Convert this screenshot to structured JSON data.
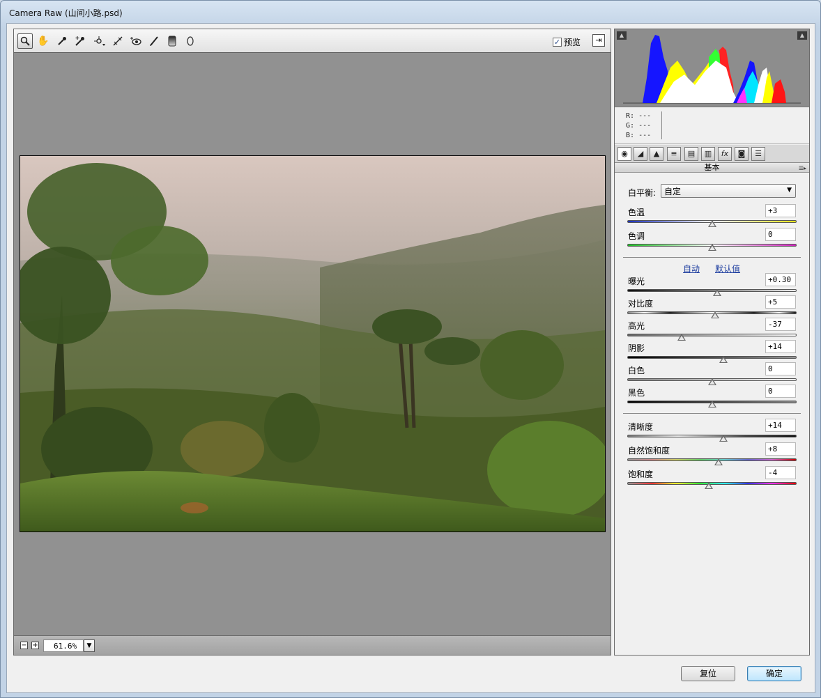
{
  "window": {
    "title": "Camera Raw (山间小路.psd)"
  },
  "toolbar": {
    "tools": [
      "zoom-tool-icon",
      "hand-tool-icon",
      "white-balance-tool-icon",
      "color-sampler-tool-icon",
      "targeted-adjustment-tool-icon",
      "straighten-tool-icon",
      "red-eye-tool-icon",
      "adjustment-brush-icon",
      "graduated-filter-icon",
      "radial-filter-icon"
    ],
    "preview_label": "预览",
    "preview_checked": true
  },
  "status": {
    "zoom_value": "61.6%"
  },
  "info": {
    "r_label": "R:",
    "g_label": "G:",
    "b_label": "B:",
    "r_value": "---",
    "g_value": "---",
    "b_value": "---"
  },
  "panel": {
    "section_title": "基本",
    "white_balance_label": "白平衡:",
    "white_balance_value": "自定",
    "auto_link": "自动",
    "default_link": "默认值"
  },
  "controls": {
    "temperature": {
      "label": "色温",
      "value": "+3",
      "level": 0.5
    },
    "tint": {
      "label": "色调",
      "value": "0",
      "level": 0.5
    },
    "exposure": {
      "label": "曝光",
      "value": "+0.30",
      "level": 0.53
    },
    "contrast": {
      "label": "对比度",
      "value": "+5",
      "level": 0.52
    },
    "highlights": {
      "label": "高光",
      "value": "-37",
      "level": 0.32
    },
    "shadows": {
      "label": "阴影",
      "value": "+14",
      "level": 0.57
    },
    "whites": {
      "label": "白色",
      "value": "0",
      "level": 0.5
    },
    "blacks": {
      "label": "黑色",
      "value": "0",
      "level": 0.5
    },
    "clarity": {
      "label": "清晰度",
      "value": "+14",
      "level": 0.57
    },
    "vibrance": {
      "label": "自然饱和度",
      "value": "+8",
      "level": 0.54
    },
    "saturation": {
      "label": "饱和度",
      "value": "-4",
      "level": 0.48
    }
  },
  "buttons": {
    "reset": "复位",
    "ok": "确定"
  }
}
